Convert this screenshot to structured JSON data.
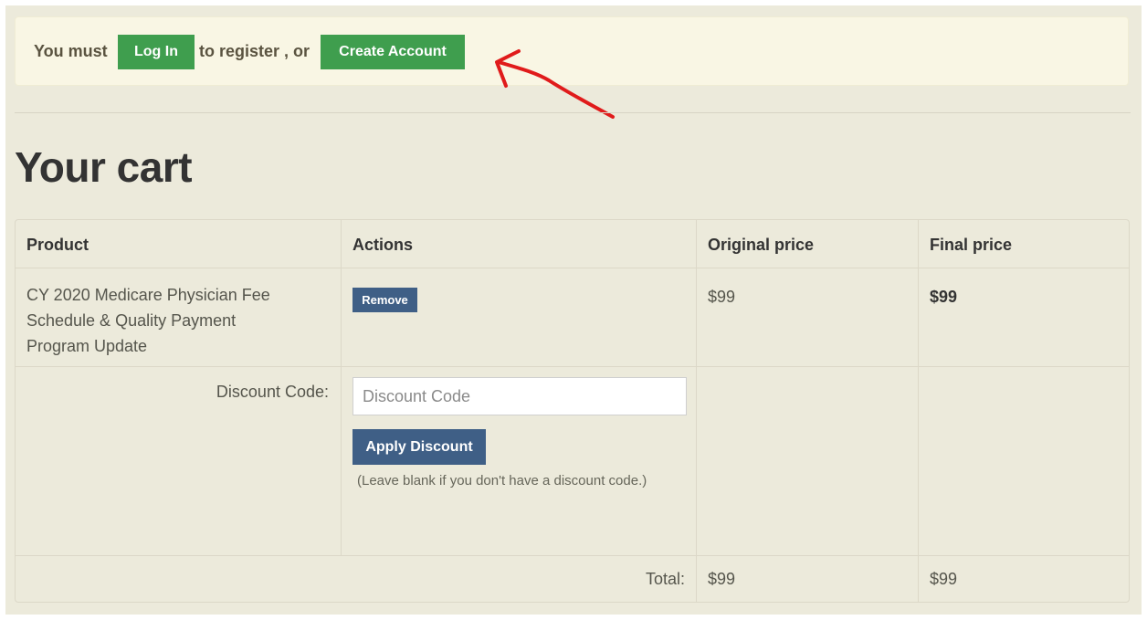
{
  "notice": {
    "prefix": "You must",
    "login_label": "Log In",
    "middle": "to register , or",
    "create_account_label": "Create Account"
  },
  "cart": {
    "title": "Your cart",
    "columns": {
      "product": "Product",
      "actions": "Actions",
      "original_price": "Original price",
      "final_price": "Final price"
    },
    "item": {
      "name_line1": "CY 2020 Medicare Physician Fee",
      "name_line2": "Schedule & Quality Payment",
      "name_line3": "Program Update",
      "remove_label": "Remove",
      "original_price": "$99",
      "final_price": "$99"
    },
    "discount": {
      "label": "Discount Code:",
      "placeholder": "Discount Code",
      "value": "",
      "apply_label": "Apply Discount",
      "hint": "(Leave blank if you don't have a discount code.)"
    },
    "total": {
      "label": "Total:",
      "original": "$99",
      "final": "$99"
    }
  },
  "colors": {
    "page_bg": "#eceadb",
    "notice_bg": "#f9f6e4",
    "green_button": "#3f9e4e",
    "blue_button": "#3f5f86",
    "annotation_red": "#e01b1b"
  },
  "annotation": {
    "icon": "red-arrow-icon"
  }
}
